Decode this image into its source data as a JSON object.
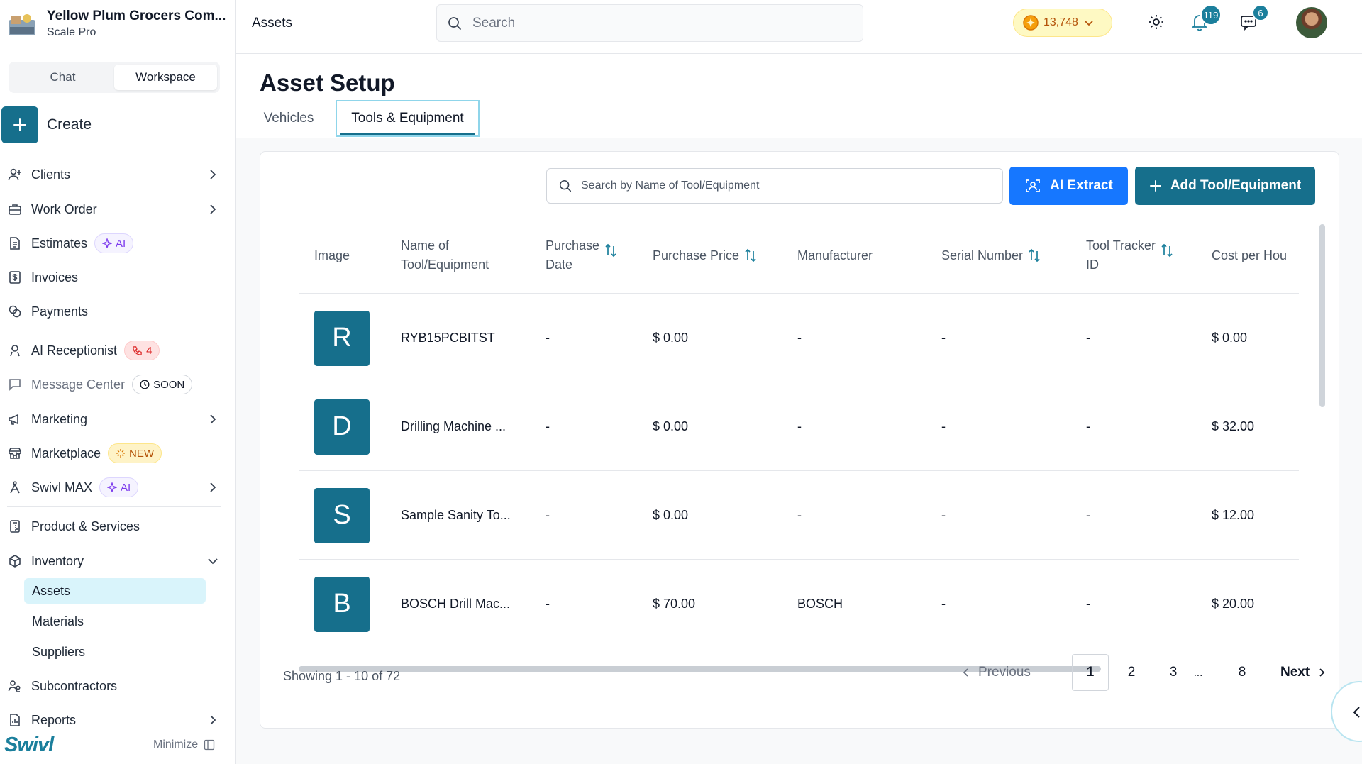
{
  "org": {
    "name": "Yellow Plum Grocers Com...",
    "plan": "Scale Pro"
  },
  "mode": {
    "chat": "Chat",
    "workspace": "Workspace"
  },
  "create_label": "Create",
  "nav": {
    "clients": "Clients",
    "work_order": "Work Order",
    "estimates": "Estimates",
    "estimates_badge": "AI",
    "invoices": "Invoices",
    "payments": "Payments",
    "ai_receptionist": "AI Receptionist",
    "ai_receptionist_badge": "4",
    "message_center": "Message Center",
    "message_center_badge": "SOON",
    "marketing": "Marketing",
    "marketplace": "Marketplace",
    "marketplace_badge": "NEW",
    "swivl_max": "Swivl MAX",
    "swivl_max_badge": "AI",
    "product_services": "Product & Services",
    "inventory": "Inventory",
    "inventory_sub": [
      "Assets",
      "Materials",
      "Suppliers"
    ],
    "subcontractors": "Subcontractors",
    "reports": "Reports"
  },
  "brand": "Swivl",
  "minimize": "Minimize",
  "topbar": {
    "breadcrumb": "Assets",
    "search_placeholder": "Search",
    "coins": "13,748",
    "notifications": "119",
    "messages": "6"
  },
  "page": {
    "title": "Asset Setup",
    "tabs": [
      "Vehicles",
      "Tools & Equipment"
    ],
    "active_tab": "Tools & Equipment"
  },
  "toolbar": {
    "search_placeholder": "Search by Name of Tool/Equipment",
    "ai_extract": "AI Extract",
    "add": "Add Tool/Equipment"
  },
  "table": {
    "headers": [
      "Image",
      "Name of\nTool/Equipment",
      "Purchase\nDate",
      "Purchase Price",
      "Manufacturer",
      "Serial Number",
      "Tool Tracker\nID",
      "Cost per Hour"
    ],
    "header_display": [
      "Image",
      "Name of",
      "Tool/Equipment",
      "Purchase",
      "Date",
      "Purchase Price",
      "Manufacturer",
      "Serial Number",
      "Tool Tracker",
      "ID",
      "Cost per Hou"
    ],
    "rows": [
      {
        "initial": "R",
        "name": "RYB15PCBITST",
        "date": "-",
        "price": "$ 0.00",
        "manufacturer": "-",
        "serial": "-",
        "tracker": "-",
        "cost": "$ 0.00"
      },
      {
        "initial": "D",
        "name": "Drilling Machine ...",
        "date": "-",
        "price": "$ 0.00",
        "manufacturer": "-",
        "serial": "-",
        "tracker": "-",
        "cost": "$ 32.00"
      },
      {
        "initial": "S",
        "name": "Sample Sanity To...",
        "date": "-",
        "price": "$ 0.00",
        "manufacturer": "-",
        "serial": "-",
        "tracker": "-",
        "cost": "$ 12.00"
      },
      {
        "initial": "B",
        "name": "BOSCH Drill Mac...",
        "date": "-",
        "price": "$ 70.00",
        "manufacturer": "BOSCH",
        "serial": "-",
        "tracker": "-",
        "cost": "$ 20.00"
      }
    ]
  },
  "pagination": {
    "showing": "Showing 1 - 10 of 72",
    "previous": "Previous",
    "next": "Next",
    "pages": [
      "1",
      "2",
      "3",
      "...",
      "8"
    ],
    "current": "1"
  },
  "colors": {
    "brand": "#166f8c",
    "ai_button": "#1677ff",
    "active_nav": "#d9f4fb"
  }
}
